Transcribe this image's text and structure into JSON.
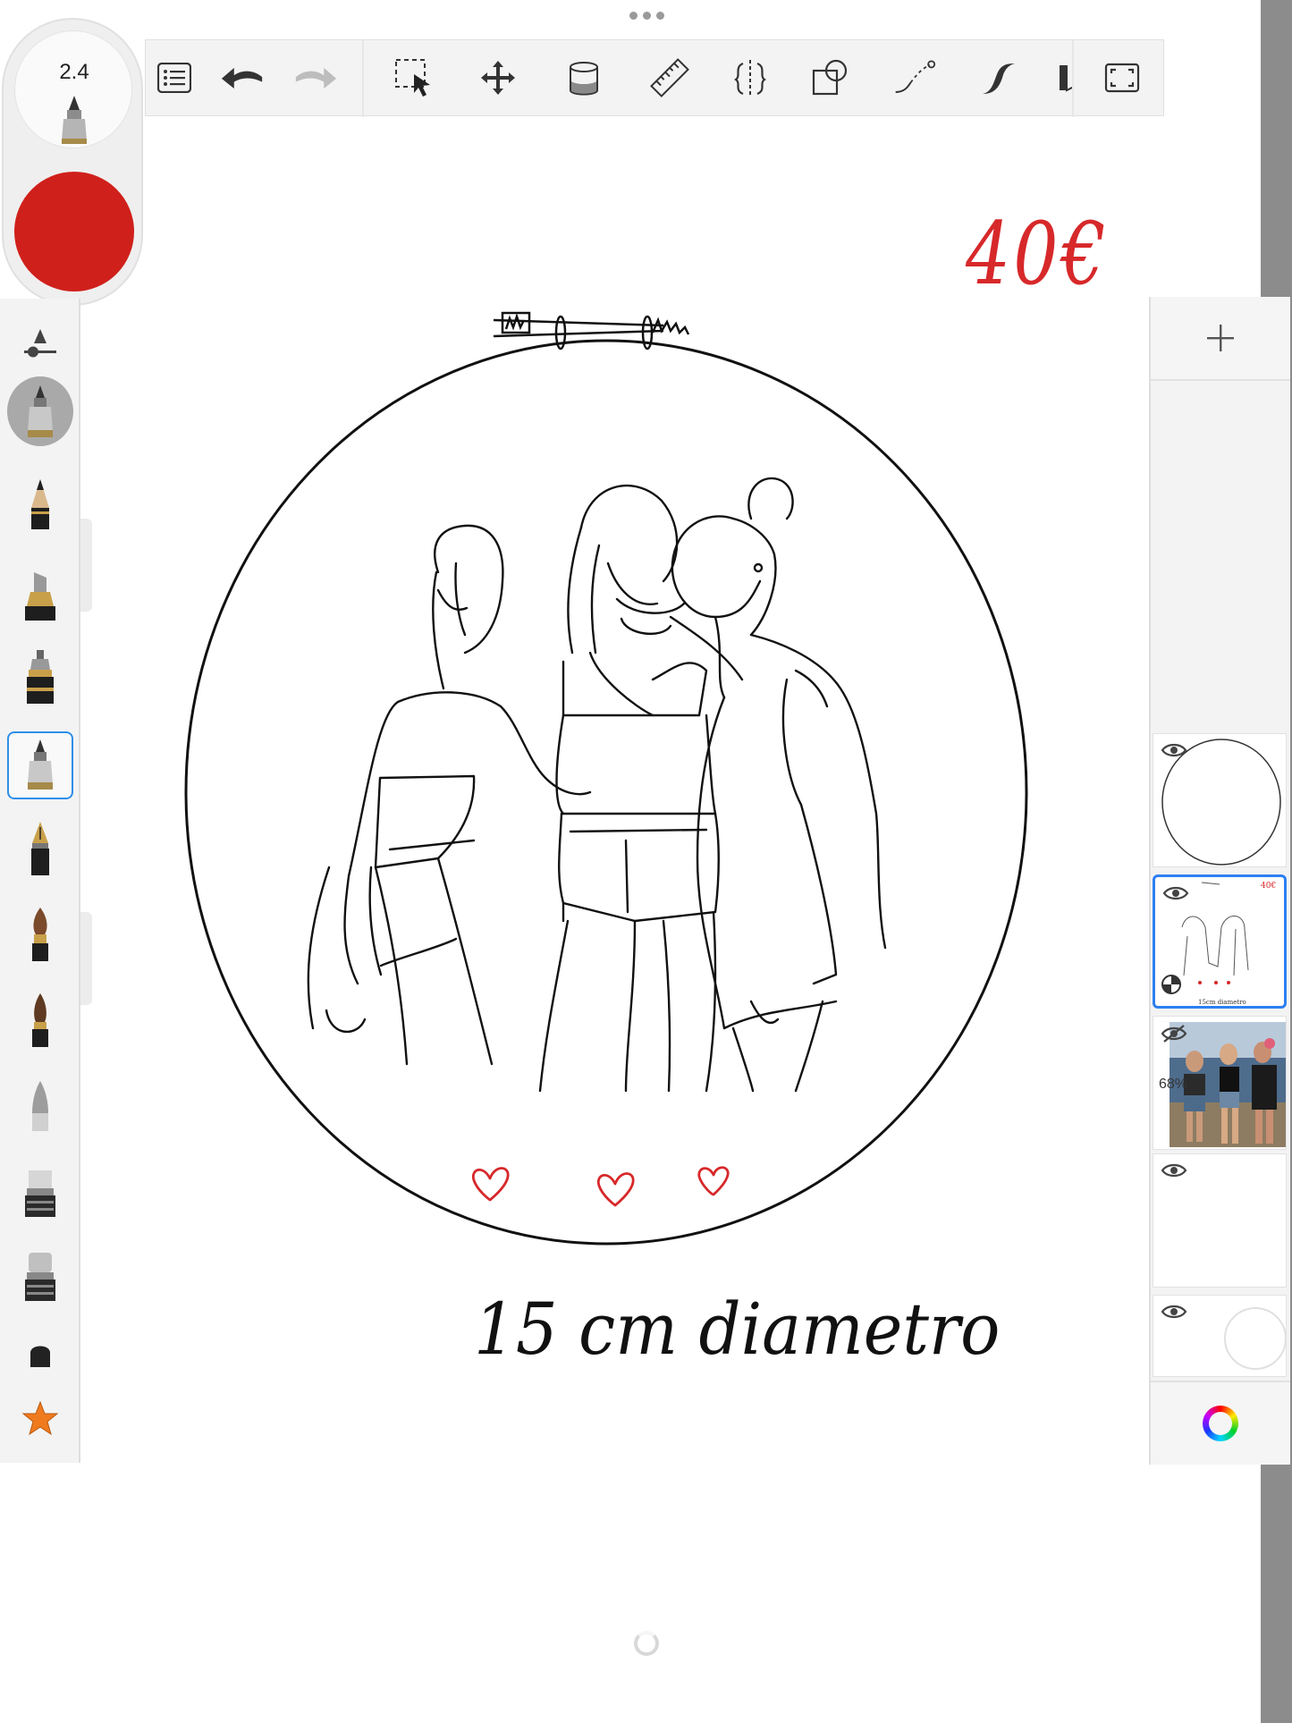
{
  "brush_puck": {
    "size_value": "2.4",
    "color": "#d0201b"
  },
  "toolbar": {
    "tools": [
      "layers-menu-icon",
      "undo-icon",
      "redo-icon",
      "selection-icon",
      "transform-icon",
      "fill-icon",
      "ruler-icon",
      "symmetry-icon",
      "shapes-icon",
      "curve-icon",
      "stroke-icon",
      "perspective-icon",
      "fullscreen-icon"
    ]
  },
  "brushes": [
    "brush-settings-icon",
    "current-brush-icon",
    "pencil-icon",
    "marker-icon",
    "felt-pen-icon",
    "ballpoint-pen-icon",
    "fountain-pen-icon",
    "paintbrush-icon",
    "ink-brush-icon",
    "airbrush-icon",
    "eraser-icon",
    "soft-eraser-icon",
    "smudge-icon",
    "favorite-star-icon"
  ],
  "canvas": {
    "price_text": "40€",
    "diameter_text": "15 cm diametro"
  },
  "layers": [
    {
      "name": "circle-layer",
      "visible": true
    },
    {
      "name": "drawing-layer",
      "visible": true,
      "active": true
    },
    {
      "name": "photo-layer",
      "visible": false,
      "opacity": "68%"
    },
    {
      "name": "empty-layer",
      "visible": true
    },
    {
      "name": "background-layer",
      "visible": true
    }
  ],
  "colors": {
    "accent": "#2d7ff2",
    "ink_red": "#d7282a",
    "ink_black": "#111111"
  }
}
